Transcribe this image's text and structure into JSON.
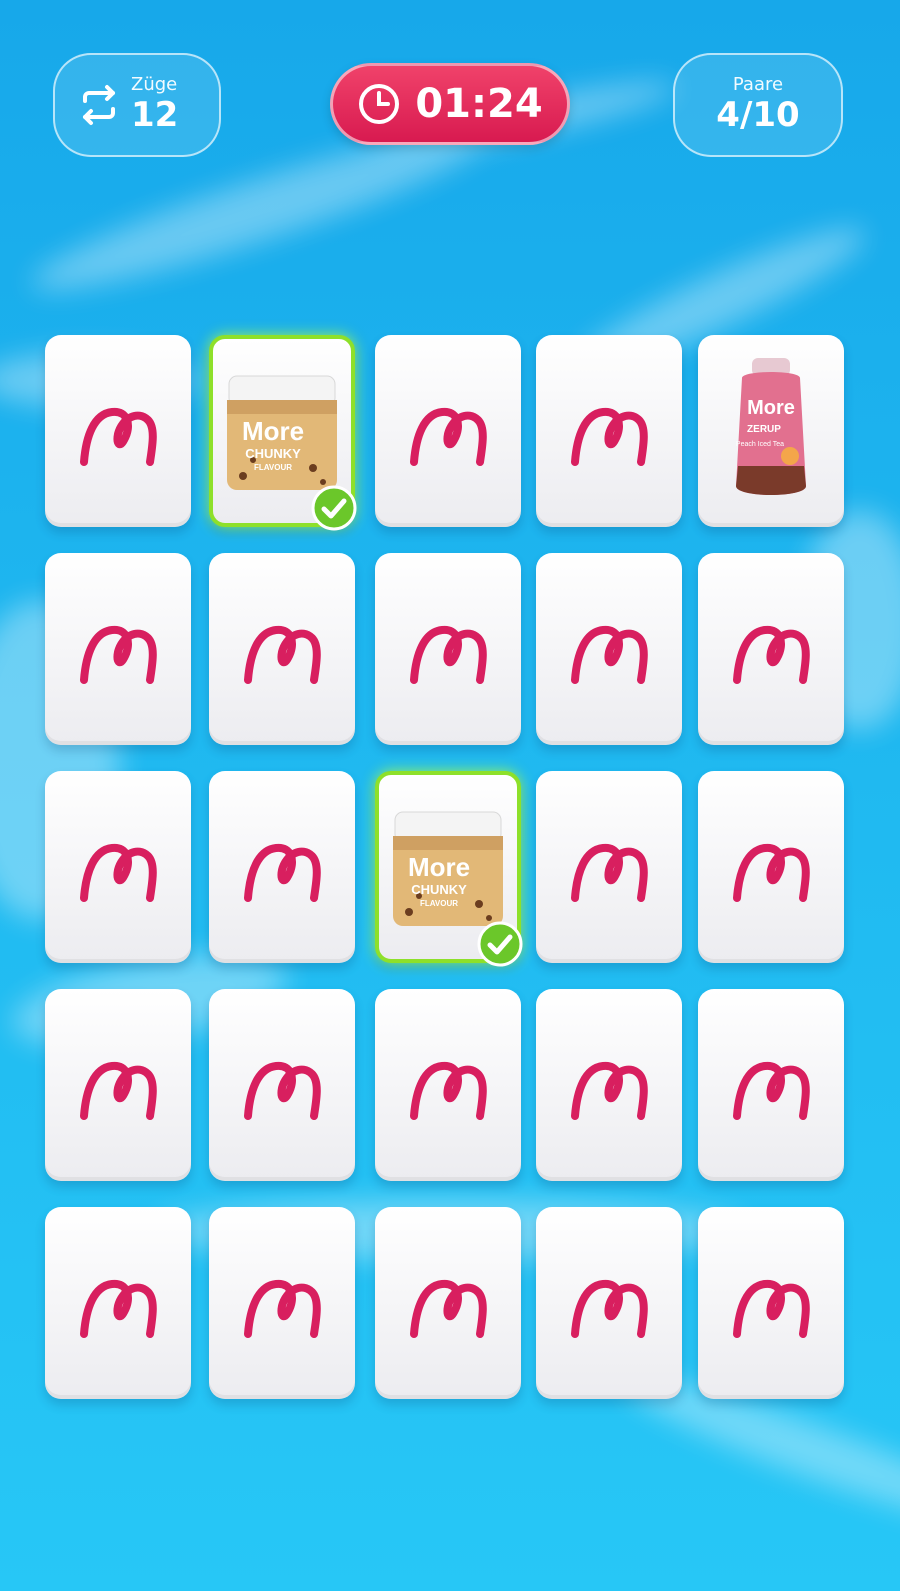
{
  "hud": {
    "moves_label": "Züge",
    "moves_value": "12",
    "timer": "01:24",
    "pairs_label": "Paare",
    "pairs_value": "4/10"
  },
  "colors": {
    "brand_pink": "#d81f5f",
    "timer_red": "#e02a5a",
    "match_green": "#8ee02a",
    "sky_blue": "#1fb8f0"
  },
  "icons": {
    "moves": "repeat-arrows-icon",
    "timer": "clock-icon",
    "card_back": "more-logo-icon",
    "matched": "checkmark-icon"
  },
  "cards": {
    "jar": {
      "brand": "More",
      "name": "CHUNKY",
      "sub": "FLAVOUR"
    },
    "bottle": {
      "brand": "More",
      "name": "ZERUP",
      "sub": "Peach Iced Tea"
    }
  },
  "grid": [
    [
      "back",
      "jar-matched",
      "back",
      "back",
      "bottle"
    ],
    [
      "back",
      "back",
      "back",
      "back",
      "back"
    ],
    [
      "back",
      "back",
      "jar-matched",
      "back",
      "back"
    ],
    [
      "back",
      "back",
      "back",
      "back",
      "back"
    ],
    [
      "back",
      "back",
      "back",
      "back",
      "back"
    ]
  ]
}
